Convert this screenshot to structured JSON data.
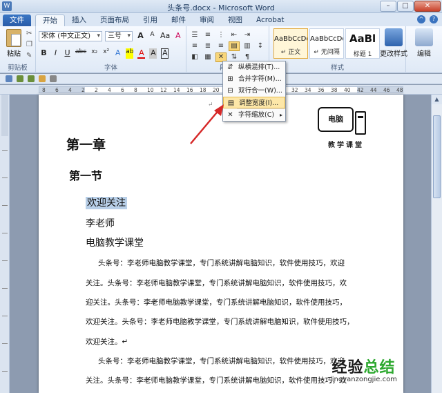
{
  "window": {
    "title": "头条号.docx - Microsoft Word",
    "min": "–",
    "max": "□",
    "close": "✕"
  },
  "tabs": [
    "文件",
    "开始",
    "插入",
    "页面布局",
    "引用",
    "邮件",
    "审阅",
    "视图",
    "Acrobat"
  ],
  "clipboard": {
    "paste_label": "粘贴",
    "group_label": "剪贴板"
  },
  "font": {
    "name_value": "宋体 (中文正文)",
    "size_value": "三号",
    "grow": "A",
    "shrink": "A",
    "aa": "Aa",
    "clear": "A",
    "bold": "B",
    "italic": "I",
    "underline": "U",
    "strike": "abc",
    "subscript": "x₂",
    "superscript": "x²",
    "effects": "A",
    "highlight": "ab",
    "color": "A",
    "char_shading": "A",
    "char_border": "A",
    "group_label": "字体"
  },
  "paragraph": {
    "group_label": "段"
  },
  "styles": {
    "items": [
      {
        "preview": "AaBbCcDd",
        "name": "↵ 正文"
      },
      {
        "preview": "AaBbCcDd",
        "name": "↵ 无间隔"
      },
      {
        "preview": "AaBl",
        "name": "标题 1"
      }
    ],
    "change_styles": "更改样式",
    "group_label": "样式"
  },
  "editing": {
    "label": "编辑"
  },
  "menu": {
    "items": [
      {
        "icon": "⇵",
        "label": "纵横混排(T)..."
      },
      {
        "icon": "⊞",
        "label": "合并字符(M)..."
      },
      {
        "icon": "⊟",
        "label": "双行合一(W)..."
      },
      {
        "icon": "▤",
        "label": "调整宽度(I)..."
      },
      {
        "icon": "✕",
        "label": "字符缩放(C)",
        "submenu": "▸"
      }
    ]
  },
  "ruler": {
    "ticks": [
      "8",
      "6",
      "4",
      "2",
      "2",
      "4",
      "6",
      "8",
      "10",
      "12",
      "14",
      "16",
      "18",
      "20",
      "22",
      "24",
      "26",
      "28",
      "30",
      "32",
      "34",
      "36",
      "38",
      "40",
      "42",
      "44",
      "46",
      "48"
    ]
  },
  "document": {
    "chapter": "第一章",
    "section": "第一节",
    "welcome": "欢迎关注",
    "teacher": "李老师",
    "classroom": "电脑教学课堂",
    "para_mark": "↵",
    "body_lines": [
      "头条号：李老师电脑教学课堂，专门系统讲解电脑知识，软件使用技巧，欢迎",
      "关注。头条号：李老师电脑教学课堂，专门系统讲解电脑知识，软件使用技巧，欢",
      "迎关注。头条号：李老师电脑教学课堂，专门系统讲解电脑知识，软件使用技巧，",
      "欢迎关注。头条号：李老师电脑教学课堂，专门系统讲解电脑知识，软件使用技巧，",
      "欢迎关注。↵",
      "头条号：李老师电脑教学课堂，专门系统讲解电脑知识，软件使用技巧，欢迎",
      "关注。头条号：李老师电脑教学课堂，专门系统讲解电脑知识，软件使用技巧，欢"
    ],
    "logo_monitor": "电脑",
    "logo_caption": "教学课堂"
  },
  "watermark": {
    "text_a": "经验",
    "text_b": "总结",
    "url": "jingyanzongjie.com"
  }
}
